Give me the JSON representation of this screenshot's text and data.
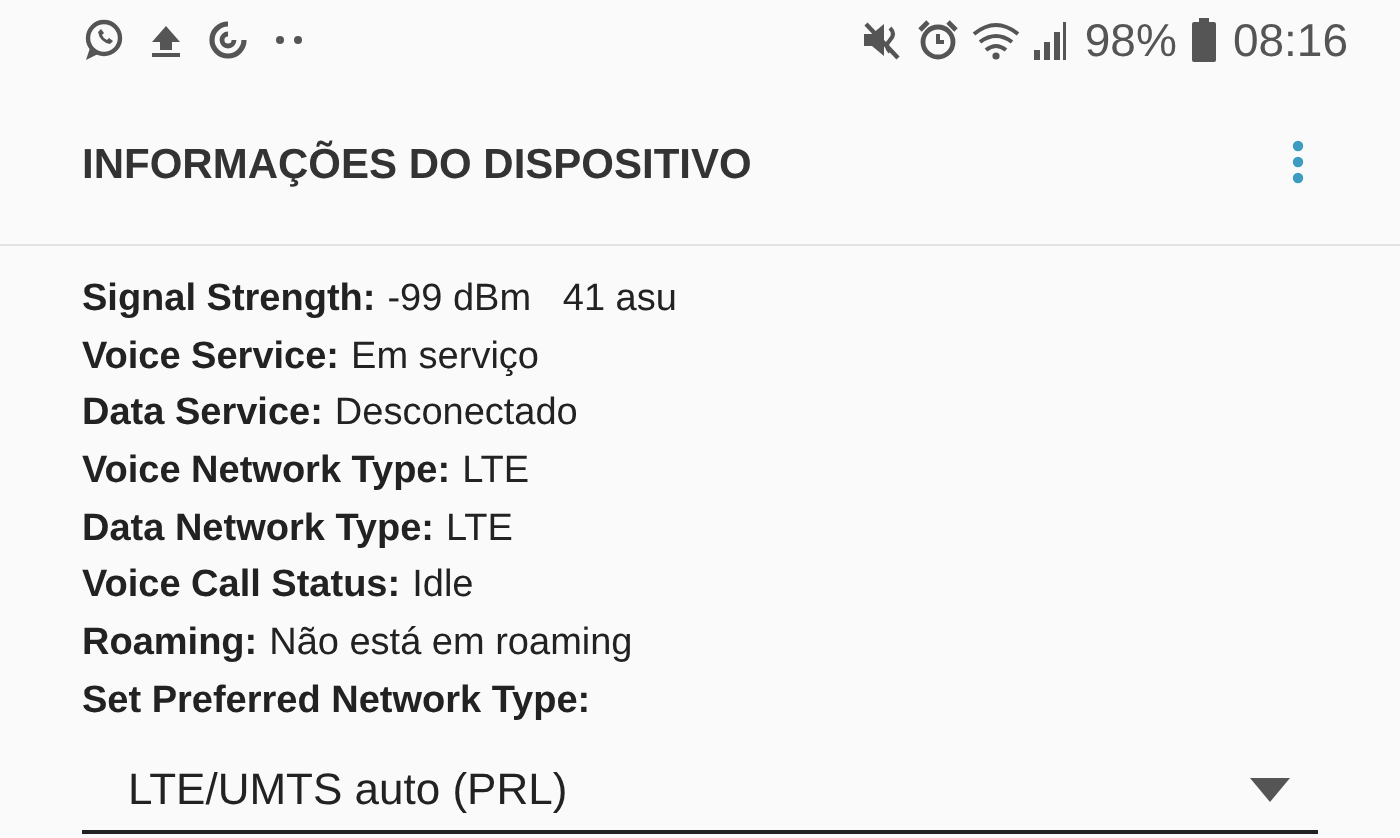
{
  "status_bar": {
    "battery": "98%",
    "time": "08:16"
  },
  "header": {
    "title": "INFORMAÇÕES DO DISPOSITIVO"
  },
  "fields": [
    {
      "label": "Signal Strength:",
      "value": "-99 dBm   41 asu"
    },
    {
      "label": "Voice Service:",
      "value": "Em serviço"
    },
    {
      "label": "Data Service:",
      "value": "Desconectado"
    },
    {
      "label": "Voice Network Type:",
      "value": "LTE"
    },
    {
      "label": "Data Network Type:",
      "value": "LTE"
    },
    {
      "label": "Voice Call Status:",
      "value": "Idle"
    },
    {
      "label": "Roaming:",
      "value": "Não está em roaming"
    }
  ],
  "preferred_network": {
    "label": "Set Preferred Network Type:",
    "value": "LTE/UMTS auto (PRL)"
  }
}
